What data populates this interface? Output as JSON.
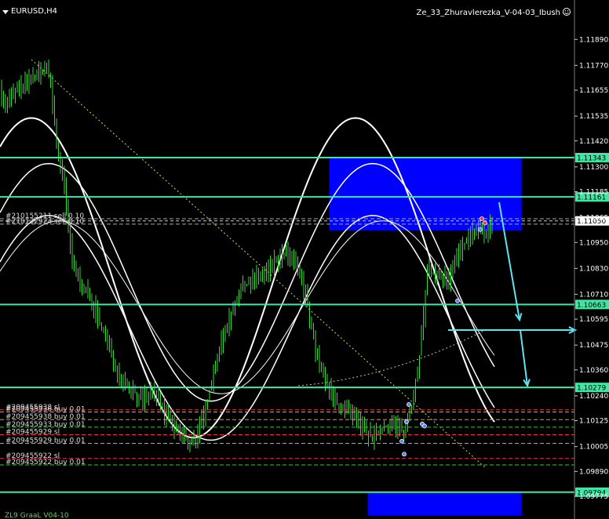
{
  "header": {
    "symbol": "EURUSD,H4",
    "indicator": "Ze_33_Zhuravlerezka_V-04-03_Ibush"
  },
  "footer": {
    "indicator_label": "ZL9 GraaL V04-10"
  },
  "colors": {
    "background": "#000000",
    "candle": "#33dd33",
    "level": "#3ee8a4",
    "zone": "#0000ff",
    "envelope": "#ffffff",
    "arrow": "#5ee6f0",
    "ma": "#d8d840"
  },
  "chart_data": {
    "type": "candlestick",
    "symbol": "EURUSD",
    "timeframe": "H4",
    "ylim": [
      1.09775,
      1.1196
    ],
    "y_ticks": [
      "1.11890",
      "1.11770",
      "1.11655",
      "1.11535",
      "1.11420",
      "1.11300",
      "1.11185",
      "1.11065",
      "1.10950",
      "1.10830",
      "1.10710",
      "1.10595",
      "1.10475",
      "1.10360",
      "1.10240",
      "1.10125",
      "1.10005",
      "1.09890",
      "1.09775"
    ],
    "price_levels": [
      {
        "value": 1.11343,
        "label": "1.11343"
      },
      {
        "value": 1.11161,
        "label": "1.11161"
      },
      {
        "value": 1.10663,
        "label": "1.10663"
      },
      {
        "value": 1.10279,
        "label": "1.10279"
      },
      {
        "value": 1.09794,
        "label": "1.09794"
      }
    ],
    "current_price": {
      "value": 1.1105,
      "label": "1.11050"
    },
    "zones": [
      {
        "x0": 0.573,
        "x1": 0.908,
        "y_top": 1.11343,
        "y_bottom": 1.11005
      },
      {
        "x0": 0.64,
        "x1": 0.908,
        "y_top": 1.09794,
        "y_bottom": 1.0972
      }
    ],
    "orders": [
      {
        "label": "#210155211 sell 0.10",
        "price": 1.1106,
        "color": "#aaaaaa"
      },
      {
        "label": "#210132924 sell 0.10",
        "price": 1.11035,
        "color": "#aaaaaa"
      },
      {
        "label": "#209455938 sl",
        "price": 1.10175,
        "color": "#e03a3a"
      },
      {
        "label": "#209455936 buy 0.01",
        "price": 1.10165,
        "color": "#e0a030"
      },
      {
        "label": "#209455938 buy 0.01",
        "price": 1.1013,
        "color": "#e0a030"
      },
      {
        "label": "#209455933 buy 0.01",
        "price": 1.10095,
        "color": "#3ac43a"
      },
      {
        "label": "#209455929 sl",
        "price": 1.1006,
        "color": "#e03a3a"
      },
      {
        "label": "#209455929 buy 0.01",
        "price": 1.1002,
        "color": "#e0a030"
      },
      {
        "label": "#209455922 sl",
        "price": 1.0995,
        "color": "#e03a3a"
      },
      {
        "label": "#209455922 buy 0.01",
        "price": 1.0992,
        "color": "#3ac43a"
      }
    ],
    "grid": false,
    "legend": "none"
  }
}
